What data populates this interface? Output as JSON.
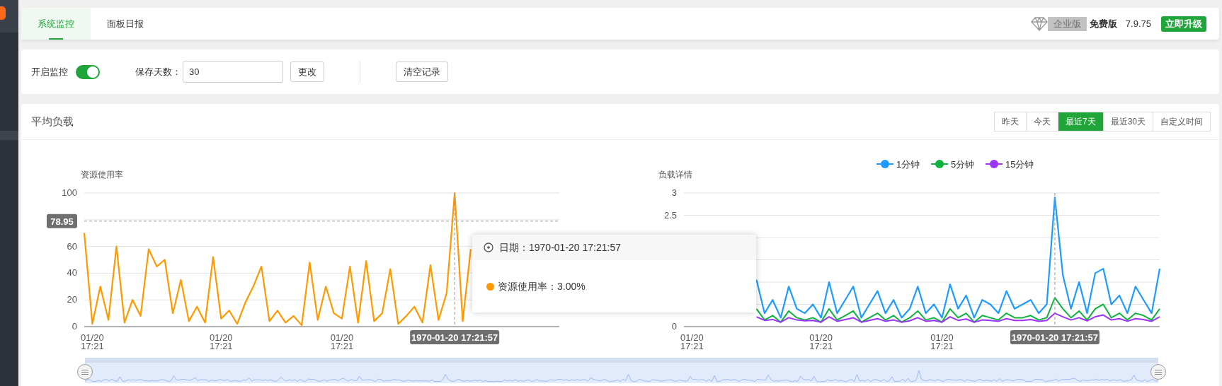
{
  "tabs": [
    {
      "label": "系统监控",
      "selected": true
    },
    {
      "label": "面板日报",
      "selected": false
    }
  ],
  "edition": {
    "enterprise_label": "企业版",
    "plan": "免费版",
    "version": "7.9.75",
    "upgrade_button": "立即升级"
  },
  "monitor_settings": {
    "toggle_label": "开启监控",
    "on": true,
    "retention_label": "保存天数：",
    "retention_days": "30",
    "change_button": "更改",
    "clear_button": "清空记录"
  },
  "load_panel": {
    "title": "平均负载",
    "ranges": [
      {
        "label": "昨天",
        "selected": false
      },
      {
        "label": "今天",
        "selected": false
      },
      {
        "label": "最近7天",
        "selected": true
      },
      {
        "label": "最近30天",
        "selected": false
      },
      {
        "label": "自定义时间",
        "selected": false
      }
    ],
    "usage_chart": {
      "pointer_time": "1970-01-20 17:21:57",
      "chart_data": {
        "type": "line",
        "ylabel": "资源使用率",
        "grid": true,
        "ylim": [
          0,
          100
        ],
        "yticks": [
          0,
          20,
          40,
          60,
          100
        ],
        "categories": [
          null,
          "01/20 17:21",
          null,
          null,
          null,
          null,
          null,
          null,
          null,
          null,
          null,
          null,
          null,
          null,
          null,
          null,
          null,
          "01/20 17:21",
          null,
          null,
          null,
          null,
          null,
          null,
          null,
          null,
          null,
          null,
          null,
          null,
          null,
          null,
          "01/20 17:21",
          null,
          null,
          null,
          null,
          null,
          null,
          null,
          null,
          null,
          null,
          null,
          null,
          null,
          null,
          null,
          null,
          null,
          null,
          null,
          null,
          null,
          null,
          null,
          null,
          null,
          null,
          null
        ],
        "ref_lines": [
          {
            "axis": "y",
            "value": 78.95,
            "label": "78.95"
          }
        ],
        "series": [
          {
            "color": "#ff9900",
            "values": [
              70,
              2,
              30,
              5,
              60,
              3,
              20,
              8,
              58,
              45,
              50,
              10,
              35,
              4,
              15,
              3,
              52,
              6,
              12,
              2,
              18,
              30,
              45,
              4,
              12,
              3,
              8,
              1,
              48,
              5,
              30,
              10,
              6,
              45,
              3,
              49,
              4,
              10,
              43,
              2,
              8,
              15,
              3,
              46,
              5,
              25,
              100,
              4,
              58,
              null,
              null,
              null,
              null,
              null,
              null,
              null,
              null,
              null,
              null,
              null
            ]
          }
        ]
      }
    },
    "load_chart": {
      "pointer_time": "1970-01-20 17:21:57",
      "chart_data": {
        "type": "line",
        "ylabel": "负载详情",
        "grid": true,
        "legend": true,
        "ylim": [
          0,
          3
        ],
        "yticks": [
          0,
          2.5,
          3
        ],
        "categories": [
          null,
          "01/20 17:21",
          null,
          null,
          null,
          null,
          null,
          null,
          null,
          null,
          null,
          null,
          null,
          null,
          null,
          null,
          null,
          "01/20 17:21",
          null,
          null,
          null,
          null,
          null,
          null,
          null,
          null,
          null,
          null,
          null,
          null,
          null,
          null,
          "01/20 17:21",
          null,
          null,
          null,
          null,
          null,
          null,
          null,
          null,
          null,
          null,
          null,
          null,
          null,
          null,
          null,
          null,
          null,
          null,
          null,
          null,
          null,
          null,
          null,
          null,
          null,
          null,
          null
        ],
        "series": [
          {
            "name": "1分钟",
            "color": "#1e9bff",
            "values": [
              null,
              null,
              null,
              null,
              null,
              null,
              null,
              null,
              null,
              1.05,
              0.3,
              0.6,
              0.2,
              0.9,
              0.4,
              0.3,
              0.5,
              0.2,
              1.0,
              0.3,
              0.6,
              0.9,
              0.2,
              0.5,
              0.8,
              0.3,
              0.6,
              0.2,
              0.4,
              0.9,
              0.3,
              0.5,
              0.2,
              0.95,
              0.4,
              0.7,
              0.2,
              0.6,
              0.5,
              0.3,
              0.8,
              0.4,
              0.5,
              0.6,
              0.3,
              0.5,
              2.9,
              1.15,
              0.4,
              1.0,
              0.3,
              1.2,
              1.3,
              0.5,
              0.7,
              0.3,
              0.9,
              0.6,
              0.3,
              1.3
            ]
          },
          {
            "name": "5分钟",
            "color": "#0db33c",
            "values": [
              null,
              null,
              null,
              null,
              null,
              null,
              null,
              null,
              null,
              0.4,
              0.15,
              0.25,
              0.1,
              0.35,
              0.2,
              0.15,
              0.2,
              0.1,
              0.4,
              0.15,
              0.25,
              0.35,
              0.1,
              0.2,
              0.3,
              0.15,
              0.25,
              0.1,
              0.2,
              0.35,
              0.15,
              0.2,
              0.1,
              0.4,
              0.2,
              0.3,
              0.1,
              0.25,
              0.2,
              0.15,
              0.3,
              0.2,
              0.2,
              0.25,
              0.15,
              0.2,
              0.65,
              0.4,
              0.2,
              0.35,
              0.15,
              0.4,
              0.5,
              0.2,
              0.3,
              0.15,
              0.3,
              0.25,
              0.15,
              0.4
            ]
          },
          {
            "name": "15分钟",
            "color": "#9b34f5",
            "values": [
              null,
              null,
              null,
              null,
              null,
              null,
              null,
              null,
              null,
              0.22,
              0.14,
              0.16,
              0.1,
              0.2,
              0.15,
              0.13,
              0.14,
              0.1,
              0.22,
              0.12,
              0.16,
              0.2,
              0.1,
              0.14,
              0.18,
              0.12,
              0.15,
              0.1,
              0.13,
              0.2,
              0.12,
              0.14,
              0.1,
              0.22,
              0.14,
              0.17,
              0.1,
              0.15,
              0.14,
              0.12,
              0.18,
              0.14,
              0.14,
              0.16,
              0.12,
              0.14,
              0.3,
              0.22,
              0.15,
              0.2,
              0.13,
              0.22,
              0.26,
              0.15,
              0.18,
              0.12,
              0.18,
              0.16,
              0.12,
              0.22
            ]
          }
        ]
      }
    },
    "zoom_slider": {
      "level": 1
    },
    "tooltip": {
      "date_line": "日期：1970-01-20 17:21:57",
      "value_line": "资源使用率：3.00%"
    }
  }
}
